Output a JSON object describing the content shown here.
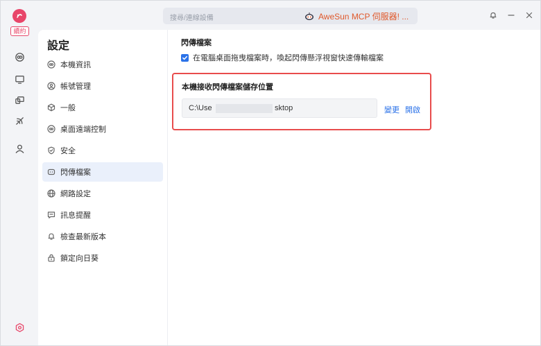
{
  "app": {
    "badge": "續約"
  },
  "topbar": {
    "search_placeholder": "搜尋/連線設備",
    "promo_text": "AweSun MCP 伺服器! ..."
  },
  "nav": {
    "title": "設定",
    "items": [
      {
        "label": "本機資訊",
        "icon": "info-icon"
      },
      {
        "label": "帳號管理",
        "icon": "account-icon"
      },
      {
        "label": "一般",
        "icon": "cube-icon"
      },
      {
        "label": "桌面遠端控制",
        "icon": "remote-control-icon"
      },
      {
        "label": "安全",
        "icon": "shield-icon"
      },
      {
        "label": "閃傳檔案",
        "icon": "file-transfer-icon",
        "active": true
      },
      {
        "label": "網路設定",
        "icon": "globe-icon"
      },
      {
        "label": "訊息提醒",
        "icon": "message-icon"
      },
      {
        "label": "檢查最新版本",
        "icon": "bell-icon"
      },
      {
        "label": "鎖定向日葵",
        "icon": "lock-icon"
      }
    ]
  },
  "content": {
    "section_title": "閃傳檔案",
    "checkbox_label": "在電腦桌面拖曳檔案時，喚起閃傳懸浮視窗快速傳輸檔案",
    "checkbox_checked": true,
    "path_title": "本機接收閃傳檔案儲存位置",
    "path_value_start": "C:\\Use",
    "path_value_end": "sktop",
    "change_label": "變更",
    "open_label": "開啟"
  },
  "colors": {
    "accent": "#2b72e8",
    "highlight": "#e84c4c",
    "brand": "#e8466a",
    "promo": "#e0582a"
  }
}
